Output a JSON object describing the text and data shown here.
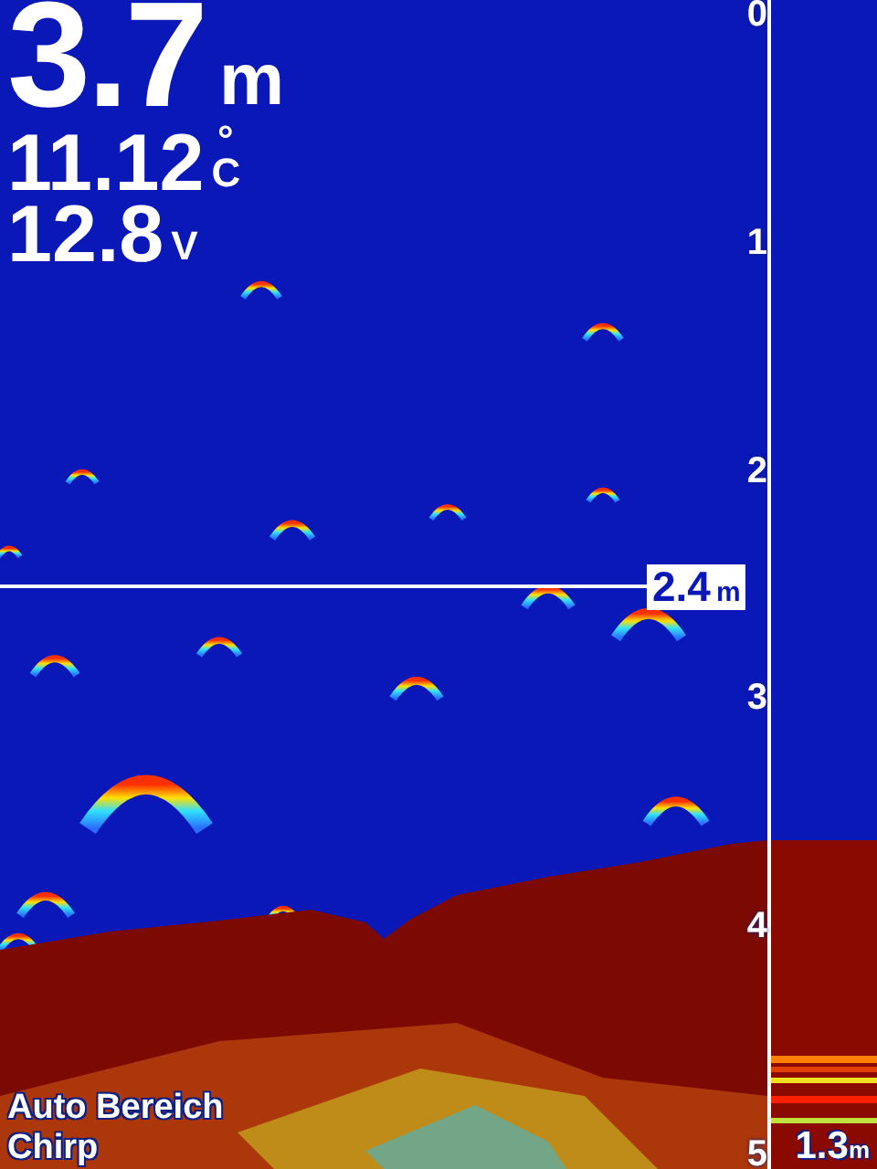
{
  "readings": [
    {
      "kind": "primary",
      "value": "3.7",
      "unit": "m"
    },
    {
      "kind": "secondary",
      "value": "11.12",
      "unit": "°C"
    },
    {
      "kind": "secondary",
      "value": "12.8",
      "unit": "V"
    }
  ],
  "depth_scale": [
    "0",
    "1",
    "2",
    "3",
    "4",
    "5"
  ],
  "cursor": {
    "value": "2.4",
    "unit": "m"
  },
  "mode_labels": [
    "Auto Bereich",
    "Chirp"
  ],
  "flasher": {
    "value": "1.3",
    "unit": "m"
  }
}
